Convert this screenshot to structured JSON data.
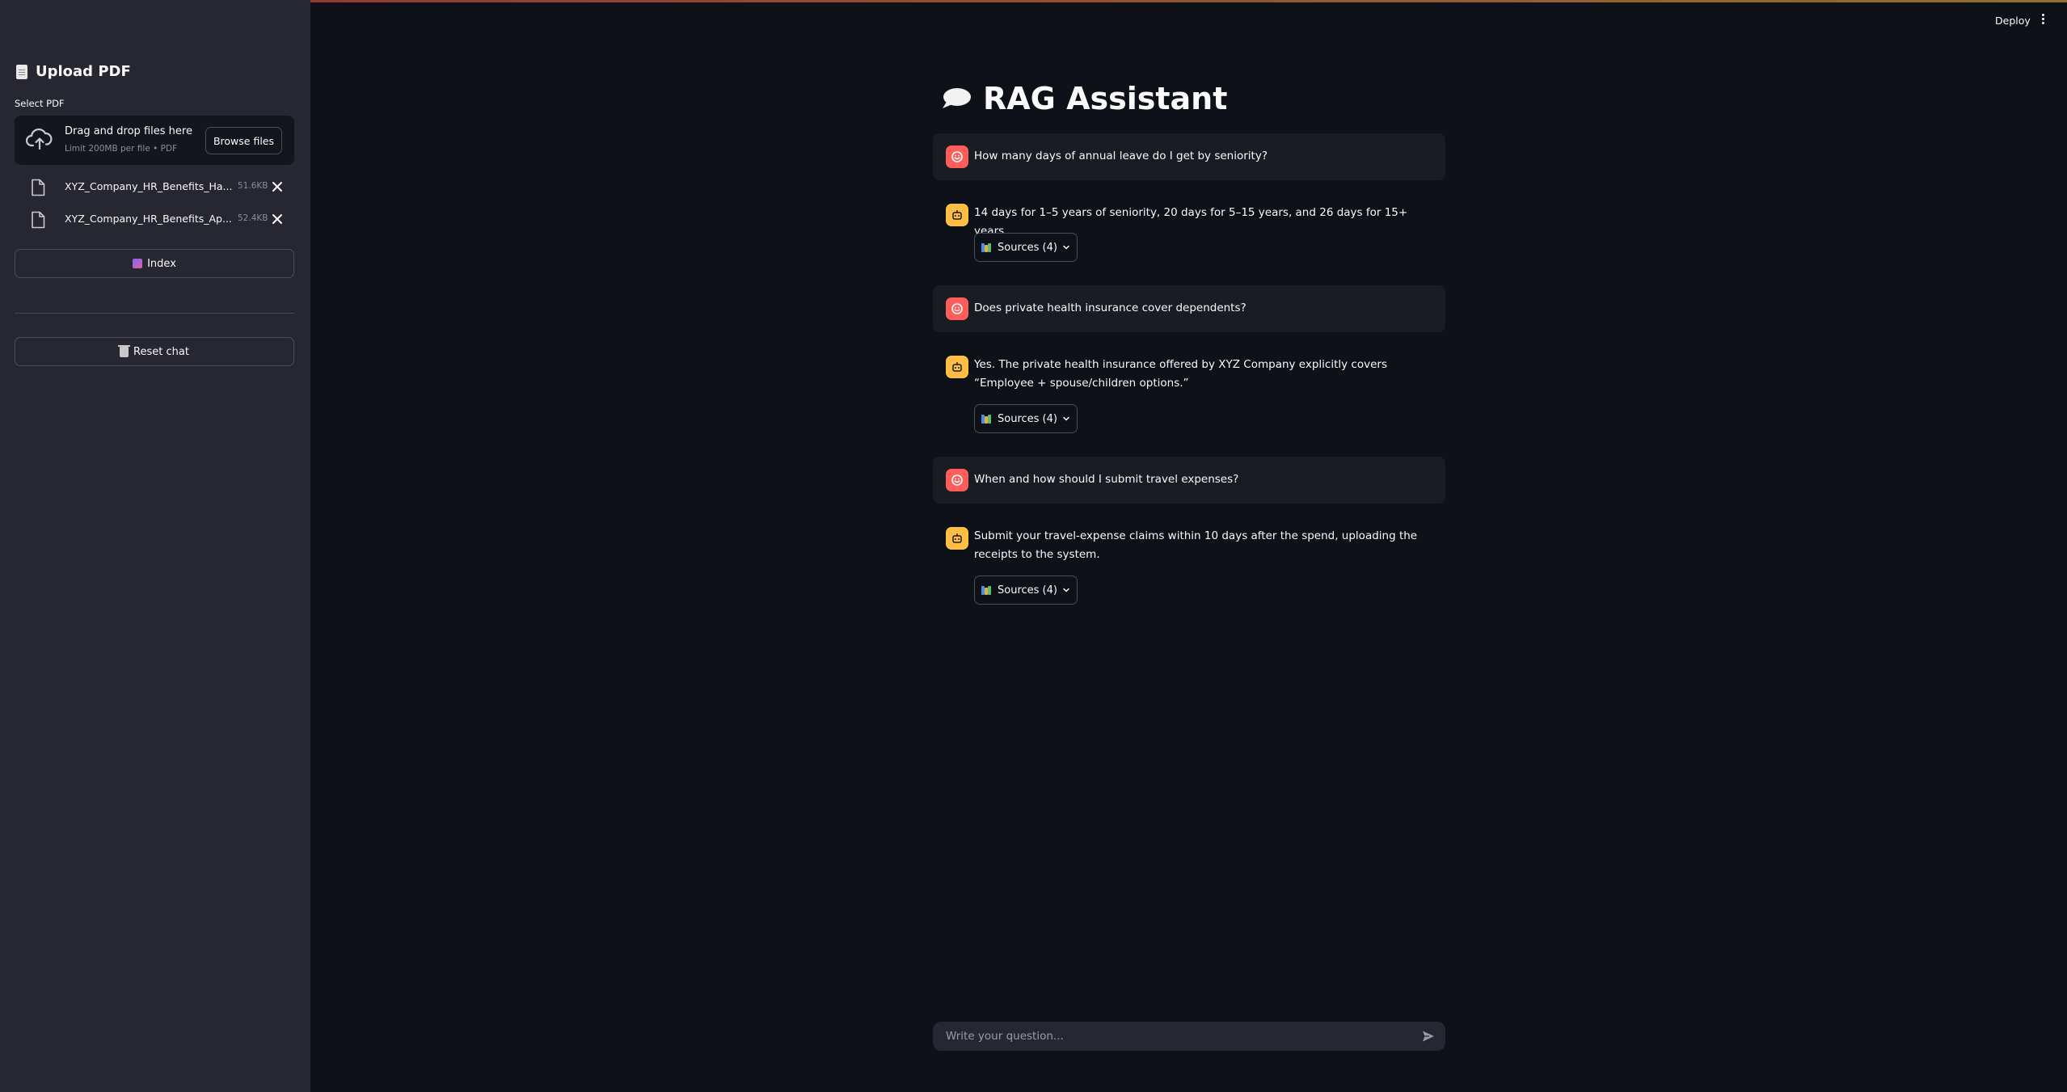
{
  "sidebar": {
    "title": "Upload PDF",
    "uploader_label": "Select PDF",
    "dropzone": {
      "main_text": "Drag and drop files here",
      "sub_text": "Limit 200MB per file • PDF",
      "browse_label": "Browse files"
    },
    "files": [
      {
        "name": "XYZ_Company_HR_Benefits_Ha...",
        "size": "51.6KB"
      },
      {
        "name": "XYZ_Company_HR_Benefits_Ap...",
        "size": "52.4KB"
      }
    ],
    "index_label": "Index",
    "reset_label": "Reset chat"
  },
  "header": {
    "deploy_label": "Deploy"
  },
  "main": {
    "title": "RAG Assistant",
    "messages": [
      {
        "role": "user",
        "text": "How many days of annual leave do I get by seniority?"
      },
      {
        "role": "assistant",
        "text": "14 days for 1–5 years of seniority, 20 days for 5–15 years, and 26 days for 15+ years.",
        "sources_label": "Sources (4)"
      },
      {
        "role": "user",
        "text": "Does private health insurance cover dependents?"
      },
      {
        "role": "assistant",
        "text": "Yes. The private health insurance offered by XYZ Company explicitly covers “Employee + spouse/children options.”",
        "sources_label": "Sources (4)"
      },
      {
        "role": "user",
        "text": "When and how should I submit travel expenses?"
      },
      {
        "role": "assistant",
        "text": "Submit your travel-expense claims within 10 days after the spend, uploading the receipts to the system.",
        "sources_label": "Sources (4)"
      }
    ]
  },
  "chat_input": {
    "placeholder": "Write your question..."
  },
  "colors": {
    "background": "#0e1117",
    "sidebar": "#262730",
    "user_avatar": "#ff5c5c",
    "assistant_avatar": "#ffbd45"
  }
}
